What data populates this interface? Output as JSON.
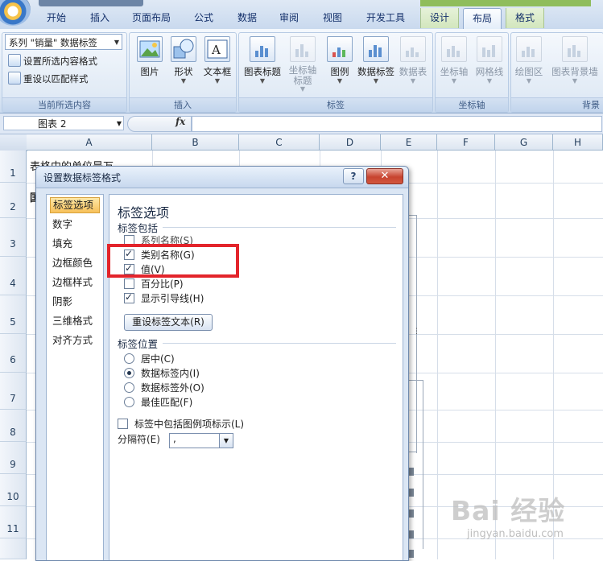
{
  "ribbon": {
    "tabs": [
      "开始",
      "插入",
      "页面布局",
      "公式",
      "数据",
      "审阅",
      "视图",
      "开发工具",
      "设计",
      "布局",
      "格式"
    ],
    "active_tab": "布局",
    "current_selection": {
      "dropdown_value": "系列 \"销量\" 数据标签",
      "format_selection": "设置所选内容格式",
      "reset_to_match_style": "重设以匹配样式",
      "group_label": "当前所选内容"
    },
    "insert_group": {
      "picture": "图片",
      "shapes": "形状",
      "text_box": "文本框",
      "group_label": "插入"
    },
    "labels_group": {
      "chart_title": "图表标题",
      "axis_titles": "坐标轴\n标题",
      "legend": "图例",
      "data_labels": "数据标签",
      "data_table": "数据表",
      "group_label": "标签"
    },
    "axes_group": {
      "axes": "坐标轴",
      "gridlines": "网格线",
      "group_label": "坐标轴"
    },
    "background_group": {
      "plot_area": "绘图区",
      "chart_wall": "图表背景墙",
      "group_label": "背景"
    }
  },
  "formula_bar": {
    "name_box": "图表 2",
    "fx": "fx",
    "formula": ""
  },
  "sheet": {
    "columns": [
      "A",
      "B",
      "C",
      "D",
      "E",
      "F",
      "G",
      "H"
    ],
    "rows": [
      "1",
      "2",
      "3",
      "4",
      "5",
      "6",
      "7",
      "8",
      "9",
      "10",
      "11"
    ],
    "cell_a1": "表格中的单位是万",
    "cell_a2": "国"
  },
  "dialog": {
    "title": "设置数据标签格式",
    "help": "?",
    "close": "✕",
    "nav": [
      "标签选项",
      "数字",
      "填充",
      "边框颜色",
      "边框样式",
      "阴影",
      "三维格式",
      "对齐方式"
    ],
    "selected_nav": "标签选项",
    "panel_heading": "标签选项",
    "label_contains": {
      "title": "标签包括",
      "series_name": "系列名称(S)",
      "category_name": "类别名称(G)",
      "value": "值(V)",
      "percentage": "百分比(P)",
      "show_leader_lines": "显示引导线(H)",
      "reset_button": "重设标签文本(R)"
    },
    "checked": {
      "series_name": false,
      "category_name": true,
      "value": true,
      "percentage": false,
      "show_leader_lines": true,
      "include_legend_key": false
    },
    "label_position": {
      "title": "标签位置",
      "center": "居中(C)",
      "inside_end": "数据标签内(I)",
      "outside_end": "数据标签外(O)",
      "best_fit": "最佳匹配(F)",
      "selected": "inside_end"
    },
    "include_legend_key": "标签中包括图例项标示(L)",
    "separator_label": "分隔符(E)",
    "separator_value": ","
  },
  "watermark": {
    "logo_text": "Bai 经验",
    "sub_text": "jingyan.baidu.com"
  },
  "colors": {
    "highlight": "#e3242b",
    "ribbon_bg": "#dae6f4",
    "selected_nav": "#f7c15a"
  }
}
